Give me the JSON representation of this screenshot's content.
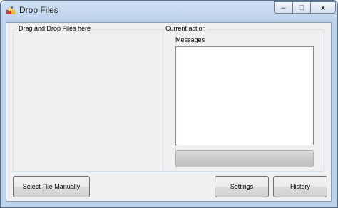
{
  "window": {
    "title": "Drop Files",
    "controls": {
      "minimize": "–",
      "maximize": "□",
      "close": "x"
    }
  },
  "drop_area": {
    "label": "Drag and Drop Files here"
  },
  "current_action": {
    "label": "Current action",
    "messages_label": "Messages",
    "messages": [],
    "progress": 0
  },
  "buttons": {
    "select_file": "Select File Manually",
    "settings": "Settings",
    "history": "History"
  }
}
